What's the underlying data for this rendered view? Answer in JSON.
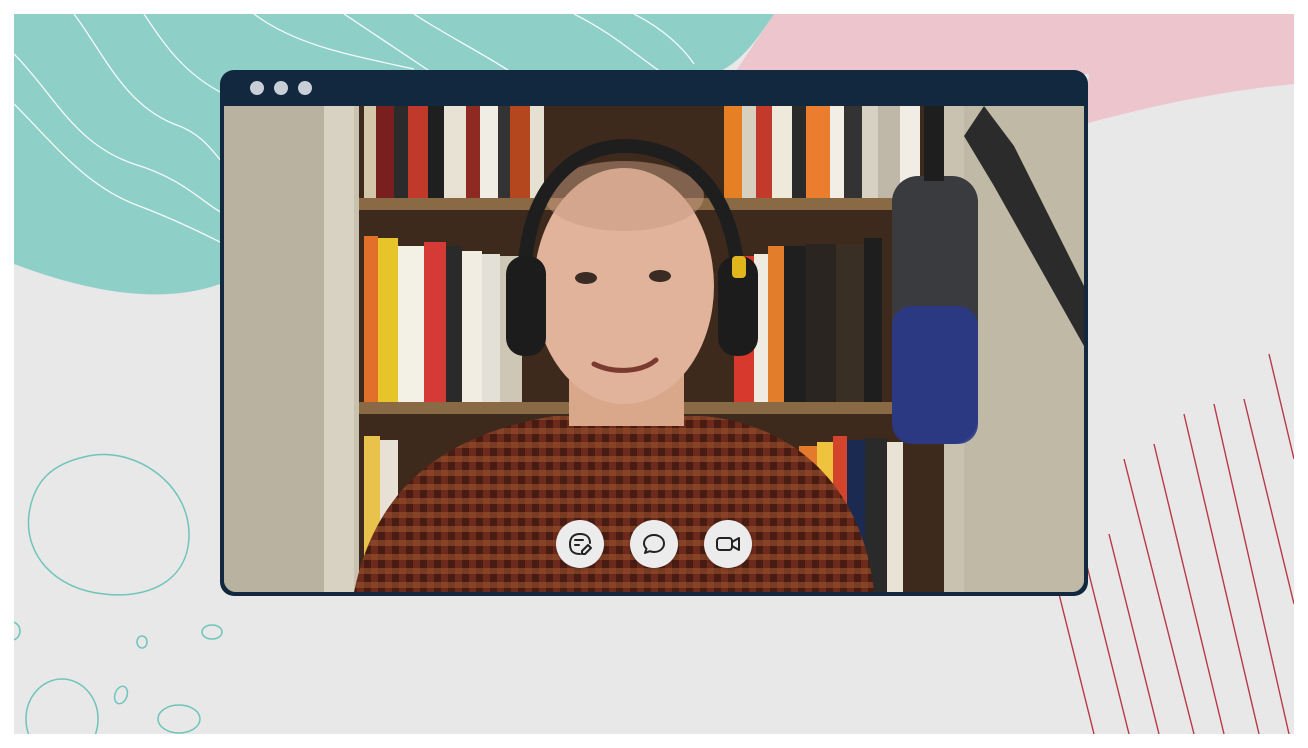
{
  "window": {
    "dots": [
      "dot-1",
      "dot-2",
      "dot-3"
    ]
  },
  "controls": [
    {
      "name": "notes-button",
      "icon": "note-edit-icon"
    },
    {
      "name": "chat-button",
      "icon": "chat-bubble-icon"
    },
    {
      "name": "video-button",
      "icon": "video-camera-icon"
    }
  ],
  "colors": {
    "frame": "#12283f",
    "teal": "#8ecfc8",
    "pink": "#ecc6cc",
    "background": "#e8e8e8",
    "red_lines": "#b83a4a"
  }
}
